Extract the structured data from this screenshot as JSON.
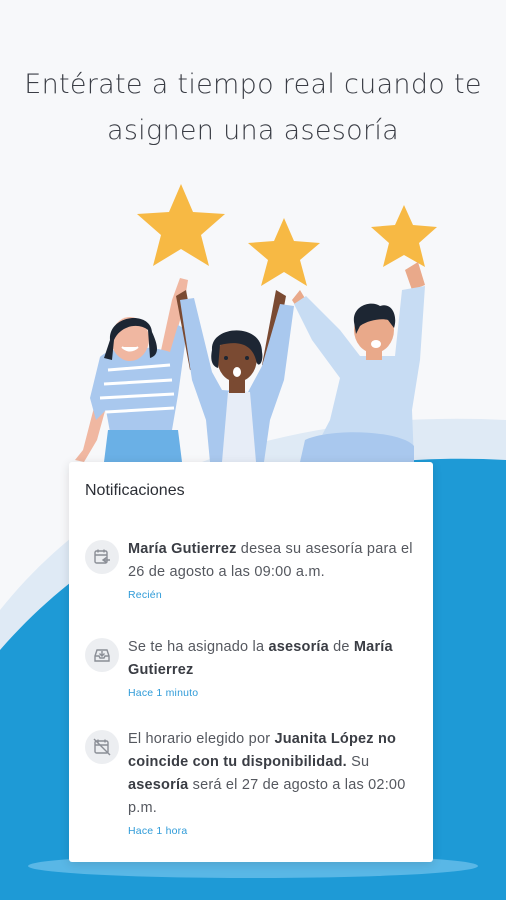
{
  "headline": {
    "line1": "Entérate a tiempo real cuando te",
    "line2": "asignen una asesoría"
  },
  "colors": {
    "star": "#f7b944",
    "accent_blue": "#1e9ad6",
    "light_blue": "#c7dcf3",
    "time_text": "#2f9bd8"
  },
  "card": {
    "title": "Notificaciones",
    "notifications": [
      {
        "icon": "calendar-arrow-icon",
        "name": "María Gutierrez",
        "text": " desea su asesoría para el 26 de agosto a las 09:00 a.m.",
        "time": "Recién"
      },
      {
        "icon": "inbox-download-icon",
        "text_before": "Se te ha asignado la ",
        "strong1": "asesoría",
        "text_middle": " de ",
        "strong2": "María Gutierrez",
        "time": "Hace 1 minuto"
      },
      {
        "icon": "calendar-off-icon",
        "text_before": "El horario elegido por ",
        "strong1": "Juanita López no coincide con tu disponibilidad.",
        "text_middle": " Su ",
        "strong2": "asesoría",
        "text_after": " será el 27 de agosto a las 02:00 p.m.",
        "time": "Hace 1 hora"
      }
    ]
  }
}
